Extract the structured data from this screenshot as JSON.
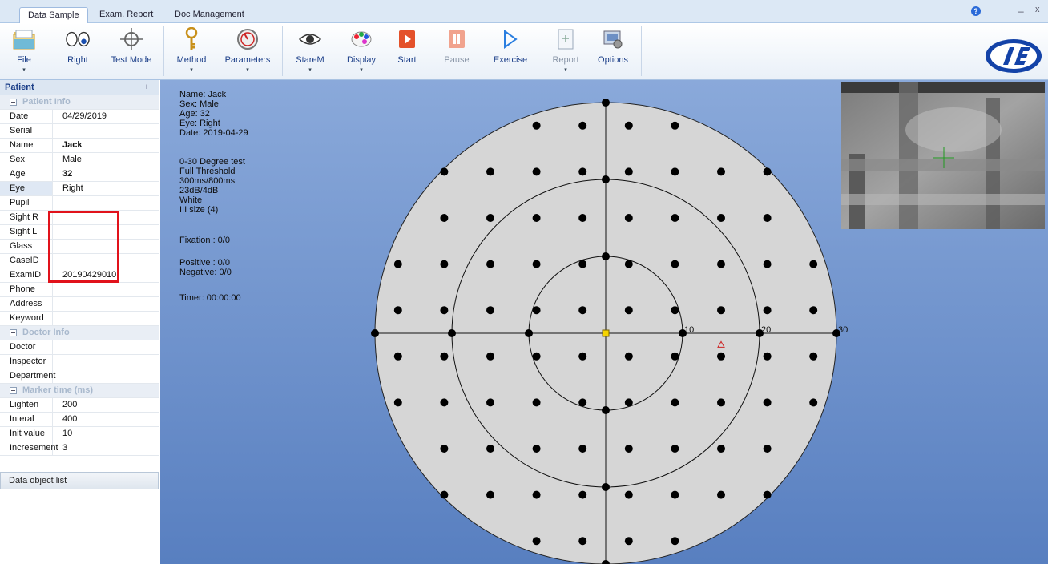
{
  "tabs": [
    {
      "label": "Data Sample",
      "active": true
    },
    {
      "label": "Exam. Report",
      "active": false
    },
    {
      "label": "Doc Management",
      "active": false
    }
  ],
  "window": {
    "help": "?",
    "minimize": "–",
    "close": "x"
  },
  "ribbon": {
    "file": "File",
    "right": "Right",
    "test_mode": "Test Mode",
    "method": "Method",
    "parameters": "Parameters",
    "starem": "StareM",
    "display": "Display",
    "start": "Start",
    "pause": "Pause",
    "exercise": "Exercise",
    "report": "Report",
    "options": "Options",
    "caret": "▾"
  },
  "panel": {
    "title": "Patient",
    "pin": "ᵻ",
    "cat_patient": "Patient Info",
    "cat_doctor": "Doctor Info",
    "cat_marker": "Marker time (ms)",
    "rows": [
      {
        "k": "Date",
        "v": "04/29/2019"
      },
      {
        "k": "Serial",
        "v": ""
      },
      {
        "k": "Name",
        "v": "Jack"
      },
      {
        "k": "Sex",
        "v": "Male"
      },
      {
        "k": "Age",
        "v": "32"
      },
      {
        "k": "Eye",
        "v": "Right"
      },
      {
        "k": "Pupil",
        "v": ""
      },
      {
        "k": "Sight R",
        "v": ""
      },
      {
        "k": "Sight L",
        "v": ""
      },
      {
        "k": "Glass",
        "v": ""
      },
      {
        "k": "CaseID",
        "v": ""
      },
      {
        "k": "ExamID",
        "v": "20190429010"
      },
      {
        "k": "Phone",
        "v": ""
      },
      {
        "k": "Address",
        "v": ""
      },
      {
        "k": "Keyword",
        "v": ""
      }
    ],
    "doctor_rows": [
      {
        "k": "Doctor",
        "v": ""
      },
      {
        "k": "Inspector",
        "v": ""
      },
      {
        "k": "Department",
        "v": ""
      }
    ],
    "marker_rows": [
      {
        "k": "Lighten",
        "v": "200"
      },
      {
        "k": "Interal",
        "v": "400"
      },
      {
        "k": "Init value",
        "v": "10"
      },
      {
        "k": "Incresement",
        "v": "3"
      }
    ],
    "data_object_list": "Data object list"
  },
  "info": {
    "name": "Name: Jack",
    "sex": "Sex: Male",
    "age": "Age: 32",
    "eye": "Eye: Right",
    "date": "Date: 2019-04-29",
    "test": "0-30 Degree test",
    "strategy": "Full Threshold",
    "timing": "300ms/800ms",
    "db": "23dB/4dB",
    "color": "White",
    "size": "III size (4)",
    "fixation": "Fixation : 0/0",
    "positive": "Positive : 0/0",
    "negative": "Negative: 0/0",
    "timer": "Timer: 00:00:00"
  },
  "field": {
    "ring_labels": [
      "10",
      "20",
      "30"
    ],
    "test_points_deg": [
      [
        3,
        3
      ],
      [
        -3,
        3
      ],
      [
        3,
        -3
      ],
      [
        -3,
        -3
      ],
      [
        9,
        3
      ],
      [
        -9,
        3
      ],
      [
        9,
        -3
      ],
      [
        -9,
        -3
      ],
      [
        3,
        9
      ],
      [
        -3,
        9
      ],
      [
        3,
        -9
      ],
      [
        -3,
        -9
      ],
      [
        9,
        9
      ],
      [
        -9,
        9
      ],
      [
        9,
        -9
      ],
      [
        -9,
        -9
      ],
      [
        15,
        3
      ],
      [
        -15,
        3
      ],
      [
        15,
        -3
      ],
      [
        -15,
        -3
      ],
      [
        3,
        15
      ],
      [
        -3,
        15
      ],
      [
        3,
        -15
      ],
      [
        -3,
        -15
      ],
      [
        15,
        9
      ],
      [
        -15,
        9
      ],
      [
        15,
        -9
      ],
      [
        -15,
        -9
      ],
      [
        9,
        15
      ],
      [
        -9,
        15
      ],
      [
        9,
        -15
      ],
      [
        -9,
        -15
      ],
      [
        21,
        3
      ],
      [
        -21,
        3
      ],
      [
        21,
        -3
      ],
      [
        -21,
        -3
      ],
      [
        3,
        21
      ],
      [
        -3,
        21
      ],
      [
        3,
        -21
      ],
      [
        -3,
        -21
      ],
      [
        21,
        9
      ],
      [
        -21,
        9
      ],
      [
        21,
        -9
      ],
      [
        -21,
        -9
      ],
      [
        9,
        21
      ],
      [
        -9,
        21
      ],
      [
        9,
        -21
      ],
      [
        -9,
        -21
      ],
      [
        15,
        15
      ],
      [
        -15,
        15
      ],
      [
        15,
        -15
      ],
      [
        -15,
        -15
      ],
      [
        27,
        3
      ],
      [
        -27,
        3
      ],
      [
        27,
        -3
      ],
      [
        -27,
        -3
      ],
      [
        3,
        27
      ],
      [
        -3,
        27
      ],
      [
        3,
        -27
      ],
      [
        -3,
        -27
      ],
      [
        21,
        15
      ],
      [
        -21,
        15
      ],
      [
        21,
        -15
      ],
      [
        -21,
        -15
      ],
      [
        15,
        21
      ],
      [
        -15,
        21
      ],
      [
        15,
        -21
      ],
      [
        -15,
        -21
      ],
      [
        27,
        9
      ],
      [
        -27,
        9
      ],
      [
        27,
        -9
      ],
      [
        -27,
        -9
      ],
      [
        9,
        27
      ],
      [
        -9,
        27
      ],
      [
        9,
        -27
      ],
      [
        -9,
        -27
      ],
      [
        21,
        21
      ],
      [
        -21,
        21
      ],
      [
        21,
        -21
      ],
      [
        -21,
        -21
      ]
    ],
    "blind_spot_deg": [
      15,
      -1.5
    ],
    "colors": {
      "disk": "#d6d6d6",
      "point": "#000000",
      "fixation": "#f5d400",
      "blind_spot": "#cc2222"
    }
  }
}
